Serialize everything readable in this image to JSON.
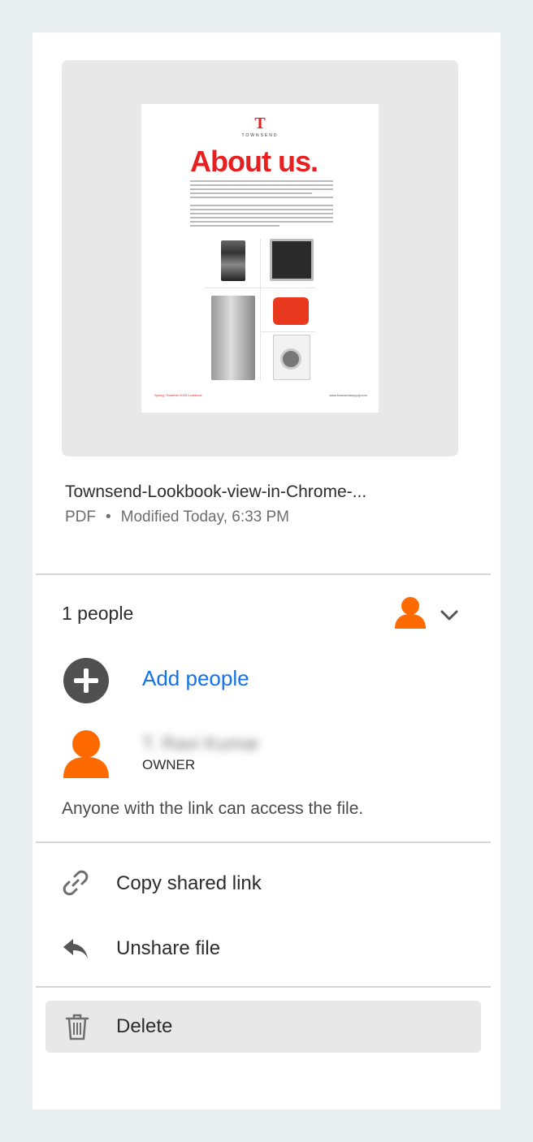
{
  "file": {
    "name": "Townsend-Lookbook-view-in-Chrome-...",
    "type": "PDF",
    "meta_separator": "•",
    "modified": "Modified Today, 6:33 PM"
  },
  "preview": {
    "logo_mark": "T",
    "logo_text": "TOWNSEND",
    "heading": "About us.",
    "footer_left": "Spring / Summer 2020 Lookbook",
    "footer_right": "www.townsendsupply.com"
  },
  "sharing": {
    "count_label": "1 people",
    "add_people_label": "Add people",
    "owner_name": "T. Ravi Kumar",
    "owner_role": "OWNER",
    "access_note": "Anyone with the link can access the file."
  },
  "actions": {
    "copy_link": "Copy shared link",
    "unshare": "Unshare file",
    "delete": "Delete"
  },
  "colors": {
    "accent": "#1473e6",
    "avatar": "#ff6a00",
    "brand_red": "#e62020"
  },
  "icons": {
    "add": "plus-circle-icon",
    "avatar": "user-icon",
    "expand": "chevron-down-icon",
    "copy_link": "link-icon",
    "unshare": "reply-arrow-icon",
    "delete": "trash-icon"
  }
}
